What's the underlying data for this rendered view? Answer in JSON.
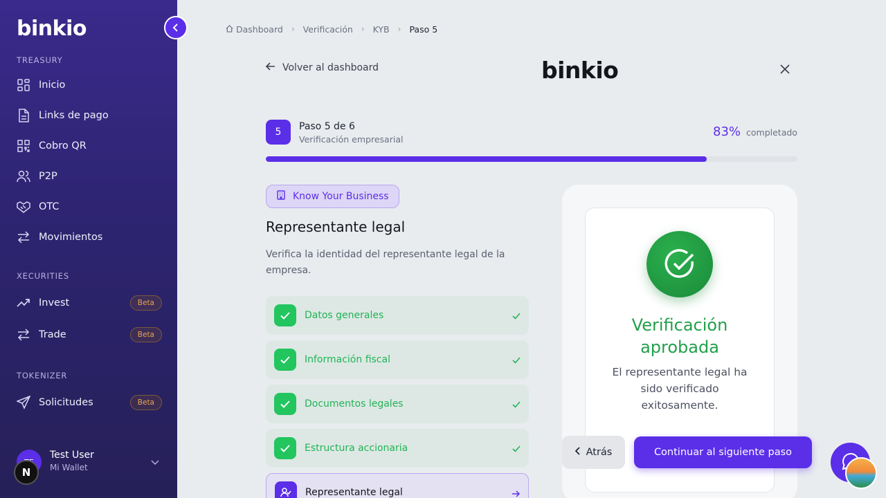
{
  "sidebar": {
    "logo": "binkio",
    "sections": {
      "treasury": "TREASURY",
      "xecurities": "XECURITIES",
      "tokenizer": "TOKENIZER"
    },
    "items": [
      {
        "label": "Inicio",
        "icon": "grid-icon"
      },
      {
        "label": "Links de pago",
        "icon": "document-icon"
      },
      {
        "label": "Cobro QR",
        "icon": "qr-icon"
      },
      {
        "label": "P2P",
        "icon": "users-icon"
      },
      {
        "label": "OTC",
        "icon": "handshake-icon"
      },
      {
        "label": "Movimientos",
        "icon": "arrows-icon"
      },
      {
        "label": "Invest",
        "icon": "trending-up-icon",
        "badge": "Beta"
      },
      {
        "label": "Trade",
        "icon": "swap-icon",
        "badge": "Beta"
      },
      {
        "label": "Solicitudes",
        "icon": "send-icon",
        "badge": "Beta"
      }
    ],
    "user": {
      "initials": "TE",
      "name": "Test User",
      "subtitle": "Mi Wallet"
    },
    "next_badge": "N"
  },
  "breadcrumb": [
    "Dashboard",
    "Verificación",
    "KYB",
    "Paso 5"
  ],
  "header": {
    "back_label": "Volver al dashboard",
    "logo": "binkio"
  },
  "progress": {
    "step_number": "5",
    "title": "Paso 5 de 6",
    "subtitle": "Verificación empresarial",
    "percent_label": "83%",
    "percent_value": 83,
    "completed_label": "completado"
  },
  "content": {
    "pill": "Know Your Business",
    "title": "Representante legal",
    "description": "Verifica la identidad del representante legal de la empresa.",
    "steps": [
      {
        "label": "Datos generales",
        "status": "done"
      },
      {
        "label": "Información fiscal",
        "status": "done"
      },
      {
        "label": "Documentos legales",
        "status": "done"
      },
      {
        "label": "Estructura accionaria",
        "status": "done"
      },
      {
        "label": "Representante legal",
        "status": "active"
      }
    ]
  },
  "result_card": {
    "title": "Verificación aprobada",
    "description": "El representante legal ha sido verificado exitosamente."
  },
  "actions": {
    "back": "Atrás",
    "next": "Continuar al siguiente paso"
  },
  "colors": {
    "accent": "#5b2ee8",
    "success": "#22c55e",
    "beta": "#e9a352"
  }
}
